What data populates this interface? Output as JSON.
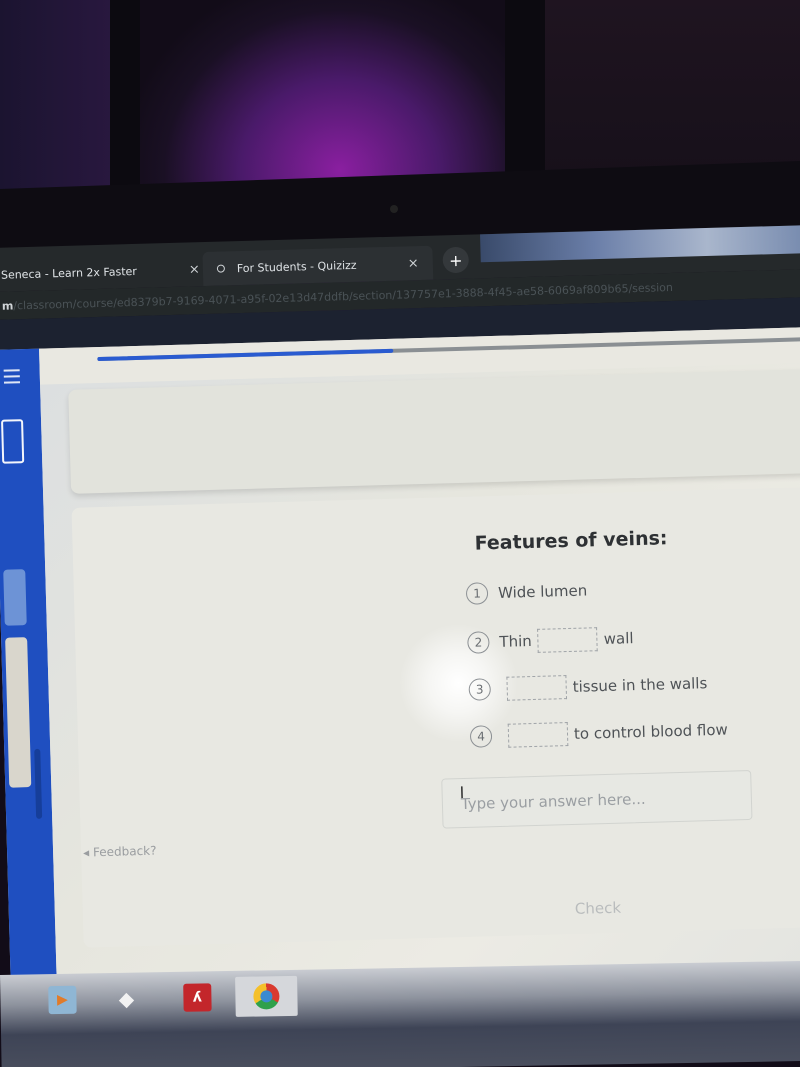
{
  "browser": {
    "tabs": [
      {
        "label": "Seneca - Learn 2x Faster",
        "active": false
      },
      {
        "label": "For Students - Quizizz",
        "active": true
      }
    ],
    "close_glyph": "×",
    "new_tab_glyph": "+",
    "url_host": "m",
    "url_path": "/classroom/course/ed8379b7-9169-4071-a95f-02e13d47ddfb/section/137757e1-3888-4f45-ae58-6069af809b65/session"
  },
  "app": {
    "progress_fraction": 0.39,
    "question": {
      "title": "Features of veins:",
      "items": [
        {
          "number": "1",
          "before": "Wide lumen",
          "after": "",
          "has_blank": false
        },
        {
          "number": "2",
          "before": "Thin",
          "after": "wall",
          "has_blank": true
        },
        {
          "number": "3",
          "before": "",
          "after": "tissue in the walls",
          "has_blank": true
        },
        {
          "number": "4",
          "before": "",
          "after": "to control blood flow",
          "has_blank": true
        }
      ]
    },
    "answer_placeholder": "Type your answer here...",
    "check_label": "Check",
    "feedback_label": "Feedback?",
    "colors": {
      "accent": "#1f4fc0",
      "progress": "#2a5bd0"
    }
  },
  "taskbar": {
    "icons": [
      "media-player-icon",
      "dropbox-icon",
      "acrobat-icon",
      "chrome-icon"
    ]
  }
}
